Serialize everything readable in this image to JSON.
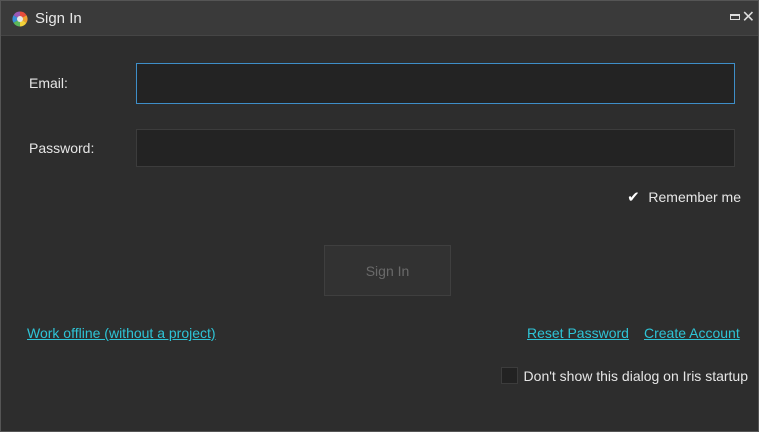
{
  "window": {
    "title": "Sign In",
    "max_icon": "maximize-icon",
    "close_glyph": "✕"
  },
  "form": {
    "email_label": "Email:",
    "email_value": "",
    "password_label": "Password:",
    "password_value": "",
    "remember_label": "Remember me",
    "remember_checked": true,
    "check_glyph": "✔",
    "signin_label": "Sign In",
    "signin_enabled": false
  },
  "links": {
    "work_offline": "Work offline (without a project)",
    "reset_password": "Reset Password",
    "create_account": "Create Account"
  },
  "startup": {
    "dont_show_label": "Don't show this dialog on Iris startup",
    "dont_show_checked": false
  },
  "colors": {
    "link": "#2ec4d6",
    "focus_border": "#3e8ec8",
    "background": "#2d2d2d"
  }
}
